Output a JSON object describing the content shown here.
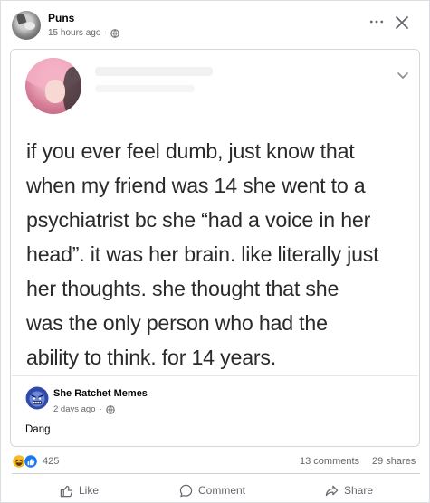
{
  "post": {
    "page_name": "Puns",
    "timestamp": "15 hours ago",
    "separator": "·",
    "privacy_icon": "globe-icon",
    "more_icon": "more-dots-icon",
    "close_icon": "close-icon"
  },
  "shared": {
    "tweet_lines": [
      "if you ever feel dumb, just know that",
      "when my friend was 14 she went to a",
      "psychiatrist bc she “had a voice in her",
      "head”. it was her brain. like literally just",
      "her thoughts. she thought that she",
      "was the only person who had the",
      "ability to think. for 14 years."
    ],
    "original_page": "She Ratchet Memes",
    "original_timestamp": "2 days ago",
    "separator": "·",
    "caption": "Dang"
  },
  "stats": {
    "reaction_count": "425",
    "comments": "13 comments",
    "shares": "29 shares"
  },
  "actions": {
    "like": "Like",
    "comment": "Comment",
    "share": "Share"
  },
  "colors": {
    "secondary_text": "#65676b",
    "like_blue": "#1877f2",
    "haha_yellow": "#f7b928"
  }
}
